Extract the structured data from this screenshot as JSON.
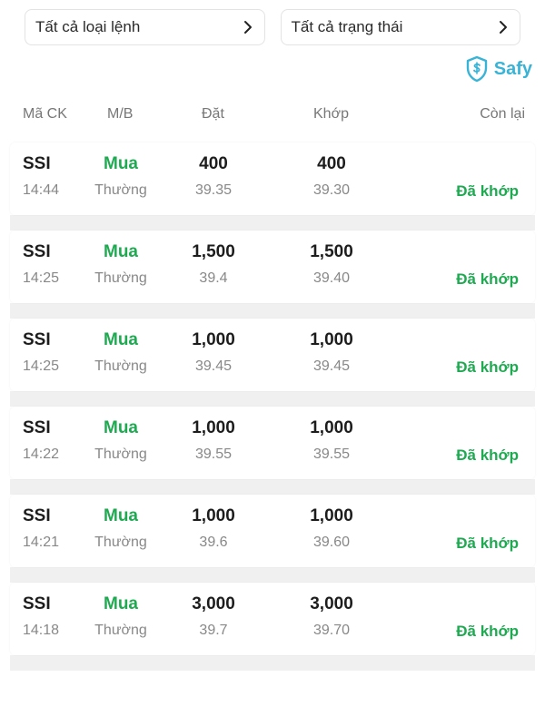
{
  "filters": {
    "order_type": "Tất cả loại lệnh",
    "status": "Tất cả trạng thái"
  },
  "brand": {
    "name": "Safy",
    "color": "#39b4d6"
  },
  "columns": {
    "symbol": "Mã CK",
    "side": "M/B",
    "order": "Đặt",
    "matched": "Khớp",
    "remaining": "Còn lại"
  },
  "colors": {
    "buy": "#1faa52",
    "matched_status": "#1faa52"
  },
  "orders": [
    {
      "symbol": "SSI",
      "time": "14:44",
      "side": "Mua",
      "type": "Thường",
      "order_qty": "400",
      "order_price": "39.35",
      "matched_qty": "400",
      "matched_price": "39.30",
      "status": "Đã khớp"
    },
    {
      "symbol": "SSI",
      "time": "14:25",
      "side": "Mua",
      "type": "Thường",
      "order_qty": "1,500",
      "order_price": "39.4",
      "matched_qty": "1,500",
      "matched_price": "39.40",
      "status": "Đã khớp"
    },
    {
      "symbol": "SSI",
      "time": "14:25",
      "side": "Mua",
      "type": "Thường",
      "order_qty": "1,000",
      "order_price": "39.45",
      "matched_qty": "1,000",
      "matched_price": "39.45",
      "status": "Đã khớp"
    },
    {
      "symbol": "SSI",
      "time": "14:22",
      "side": "Mua",
      "type": "Thường",
      "order_qty": "1,000",
      "order_price": "39.55",
      "matched_qty": "1,000",
      "matched_price": "39.55",
      "status": "Đã khớp"
    },
    {
      "symbol": "SSI",
      "time": "14:21",
      "side": "Mua",
      "type": "Thường",
      "order_qty": "1,000",
      "order_price": "39.6",
      "matched_qty": "1,000",
      "matched_price": "39.60",
      "status": "Đã khớp"
    },
    {
      "symbol": "SSI",
      "time": "14:18",
      "side": "Mua",
      "type": "Thường",
      "order_qty": "3,000",
      "order_price": "39.7",
      "matched_qty": "3,000",
      "matched_price": "39.70",
      "status": "Đã khớp"
    }
  ]
}
